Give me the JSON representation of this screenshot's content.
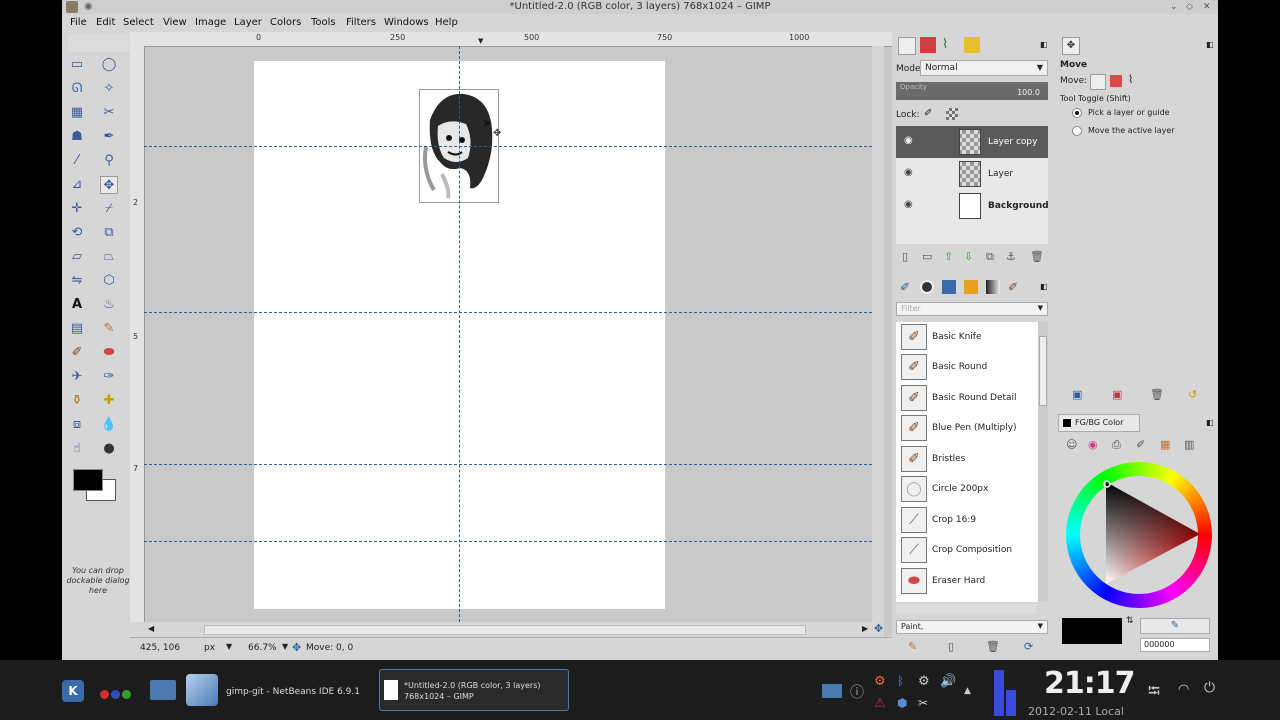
{
  "window": {
    "title": "*Untitled-2.0 (RGB color, 3 layers) 768x1024 – GIMP"
  },
  "menubar": {
    "items": [
      "File",
      "Edit",
      "Select",
      "View",
      "Image",
      "Layer",
      "Colors",
      "Tools",
      "Filters",
      "Windows",
      "Help"
    ]
  },
  "rulers": {
    "h_labels": [
      "0",
      "250",
      "500",
      "750",
      "1000"
    ],
    "v_labels": [
      "2",
      "5",
      "7"
    ]
  },
  "toolbox": {
    "drop_hint": "You can drop dockable dialog here",
    "fg_color": "#000000",
    "bg_color": "#ffffff"
  },
  "statusbar": {
    "coords": "425, 106",
    "unit": "px",
    "zoom": "66.7%",
    "message": "Move: 0, 0"
  },
  "layers_panel": {
    "mode_label": "Mode:",
    "mode_value": "Normal",
    "opacity_label": "Opacity",
    "opacity_value": "100.0",
    "lock_label": "Lock:",
    "layers": [
      {
        "name": "Layer copy",
        "selected": true
      },
      {
        "name": "Layer",
        "selected": false
      },
      {
        "name": "Background",
        "selected": false
      }
    ]
  },
  "brushes_panel": {
    "filter_placeholder": "Filter",
    "brushes": [
      "Basic Knife",
      "Basic Round",
      "Basic Round Detail",
      "Blue Pen (Multiply)",
      "Bristles",
      "Circle 200px",
      "Crop 16:9",
      "Crop Composition",
      "Eraser Hard"
    ],
    "tag_value": "Paint,"
  },
  "tool_options": {
    "title": "Move",
    "move_label": "Move:",
    "toggle_label": "Tool Toggle  (Shift)",
    "options": [
      "Pick a layer or guide",
      "Move the active layer"
    ],
    "selected_option": 0
  },
  "fgbg_panel": {
    "tab_label": "FG/BG Color",
    "hex_value": "000000"
  },
  "taskbar": {
    "task1_label": "gimp-git - NetBeans IDE 6.9.1",
    "task2_line1": "*Untitled-2.0 (RGB color, 3 layers)",
    "task2_line2": "768x1024 – GIMP",
    "clock_time": "21:17",
    "clock_date": "2012-02-11 Local"
  }
}
